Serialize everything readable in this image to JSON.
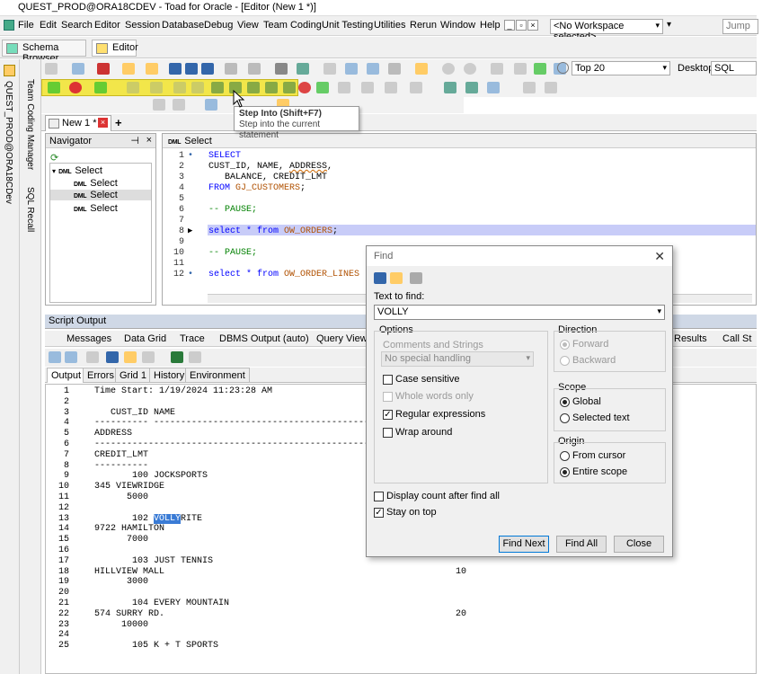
{
  "window": {
    "title": "QUEST_PROD@ORA18CDEV - Toad for Oracle - [Editor (New 1 *)]"
  },
  "menu": [
    "File",
    "Edit",
    "Search",
    "Editor",
    "Session",
    "Database",
    "Debug",
    "View",
    "Team Coding",
    "Unit Testing",
    "Utilities",
    "Rerun",
    "Window",
    "Help"
  ],
  "workspace": {
    "value": "<No Workspace selected>",
    "jump_placeholder": "Jump"
  },
  "doc_tabs": [
    "Schema Browser",
    "Editor"
  ],
  "toolbar": {
    "topn": "Top 20",
    "desktop_label": "Desktop:",
    "desktop_value": "SQL"
  },
  "tooltip": {
    "title": "Step Into (Shift+F7)",
    "desc": "Step into the current statement"
  },
  "left_strip": {
    "connection": "QUEST_PROD@ORA18CDev",
    "team_coding": "Team Coding Manager",
    "sql_recall": "SQL Recall"
  },
  "editor_tab": {
    "label": "New 1 *",
    "add": "+"
  },
  "navigator": {
    "title": "Navigator",
    "root": "Select",
    "children": [
      "Select",
      "Select",
      "Select"
    ]
  },
  "editor": {
    "header": "Select",
    "lines": [
      "1",
      "2",
      "3",
      "4",
      "5",
      "6",
      "7",
      "8",
      "9",
      "10",
      "11",
      "12"
    ],
    "code": {
      "l1": "SELECT",
      "l2a": "CUST_ID, NAME, ",
      "l2b": "ADDRESS",
      "l2c": ",",
      "l3": "   BALANCE, CREDIT_LMT",
      "l4a": "FROM ",
      "l4b": "GJ_CUSTOMERS",
      "l4c": ";",
      "l6": "-- PAUSE;",
      "l8a": "select * from ",
      "l8b": "OW_ORDERS",
      "l8c": ";",
      "l10": "-- PAUSE;",
      "l12a": "select * from ",
      "l12b": "OW_ORDER_LINES"
    }
  },
  "script_output": {
    "title": "Script Output",
    "tabs": [
      "Messages",
      "Data Grid",
      "Trace",
      "DBMS Output (auto)",
      "Query Viewer",
      "Results",
      "Call St"
    ],
    "subtabs": [
      "Output",
      "Errors",
      "Grid 1",
      "History",
      "Environment"
    ],
    "lines": [
      {
        "n": "1",
        "t": "Time Start: 1/19/2024 11:23:28 AM",
        "r": ""
      },
      {
        "n": "2",
        "t": "",
        "r": ""
      },
      {
        "n": "3",
        "t": "   CUST_ID NAME",
        "r": ""
      },
      {
        "n": "4",
        "t": "---------- ------------------------------------------------------------",
        "r": ""
      },
      {
        "n": "5",
        "t": "ADDRESS",
        "r": ""
      },
      {
        "n": "6",
        "t": "----------------------------------------------------------------------",
        "r": ""
      },
      {
        "n": "7",
        "t": "CREDIT_LMT",
        "r": ""
      },
      {
        "n": "8",
        "t": "----------",
        "r": ""
      },
      {
        "n": "9",
        "t": "       100 JOCKSPORTS",
        "r": ""
      },
      {
        "n": "10",
        "t": "345 VIEWRIDGE",
        "r": ""
      },
      {
        "n": "11",
        "t": "      5000",
        "r": ""
      },
      {
        "n": "12",
        "t": "",
        "r": ""
      },
      {
        "n": "13",
        "t": "       102 ",
        "sel": "VOLLY",
        "rest": "RITE",
        "r": ""
      },
      {
        "n": "14",
        "t": "9722 HAMILTON",
        "r": ""
      },
      {
        "n": "15",
        "t": "      7000",
        "r": ""
      },
      {
        "n": "16",
        "t": "",
        "r": ""
      },
      {
        "n": "17",
        "t": "       103 JUST TENNIS",
        "r": ""
      },
      {
        "n": "18",
        "t": "HILLVIEW MALL",
        "r": "10"
      },
      {
        "n": "19",
        "t": "      3000",
        "r": ""
      },
      {
        "n": "20",
        "t": "",
        "r": ""
      },
      {
        "n": "21",
        "t": "       104 EVERY MOUNTAIN",
        "r": ""
      },
      {
        "n": "22",
        "t": "574 SURRY RD.",
        "r": "20"
      },
      {
        "n": "23",
        "t": "     10000",
        "r": ""
      },
      {
        "n": "24",
        "t": "",
        "r": ""
      },
      {
        "n": "25",
        "t": "       105 K + T SPORTS",
        "r": ""
      }
    ]
  },
  "find": {
    "title": "Find",
    "text_label": "Text to find:",
    "text_value": "VOLLY",
    "options_label": "Options",
    "comments_label": "Comments and Strings",
    "special": "No special handling",
    "case_sensitive": "Case sensitive",
    "whole_words": "Whole words only",
    "regex": "Regular expressions",
    "wrap": "Wrap around",
    "direction_label": "Direction",
    "forward": "Forward",
    "backward": "Backward",
    "scope_label": "Scope",
    "global": "Global",
    "selected_text": "Selected text",
    "origin_label": "Origin",
    "from_cursor": "From cursor",
    "entire_scope": "Entire scope",
    "display_count": "Display count after find all",
    "stay_on_top": "Stay on top",
    "find_next": "Find Next",
    "find_all": "Find All",
    "close": "Close"
  },
  "colors": {
    "highlight_line": "#c8ccf8",
    "selection": "#3a7bd5",
    "yellow_toolbar": "#f2e64a",
    "output_header": "#cfd8e6"
  }
}
